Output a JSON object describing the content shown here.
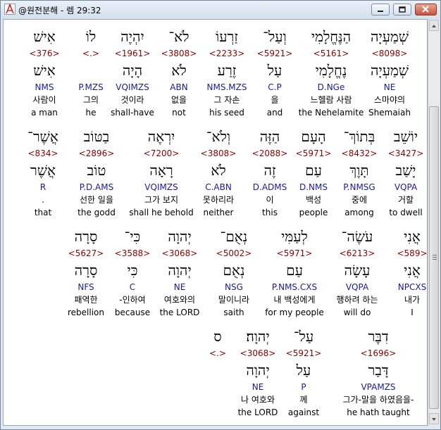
{
  "window": {
    "title": "@원전분해 - 렘 29:32",
    "colors": {
      "strong": "#8b0000",
      "morph": "#1a1aa0",
      "text": "#000000"
    }
  },
  "icons": {
    "app": "compass-drafting-icon",
    "minimize": "minimize-icon",
    "maximize": "maximize-icon",
    "close": "close-icon"
  },
  "lines": [
    {
      "words": [
        {
          "heb": "שְׁמַעְיָה",
          "strong": "<8098>",
          "heb2": "שְׁמַעְיָה",
          "morph": "NE",
          "kor": "스마야의",
          "eng": "Shemaiah"
        },
        {
          "heb": "הַנֶּחֱלָמִי",
          "strong": "<5161>",
          "heb2": "נֶחֱלָמִי",
          "morph": "D.NGe",
          "kor": "느헬람 사람",
          "eng": "the Nehelamite"
        },
        {
          "heb": "וְעַל־",
          "strong": "<5921>",
          "heb2": "עַל",
          "morph": "C.P",
          "kor": "을",
          "eng": "and"
        },
        {
          "heb": "זַרְעוֹ",
          "strong": "<2233>",
          "heb2": "זֶרַע",
          "morph": "NMS.MZS",
          "kor": "그 자손",
          "eng": "his seed"
        },
        {
          "heb": "לֹא־",
          "strong": "<3808>",
          "heb2": "לֹא",
          "morph": "ABN",
          "kor": "없을",
          "eng": "not"
        },
        {
          "heb": "יִהְיֶה",
          "strong": "<1961>",
          "heb2": "הָיָה",
          "morph": "VQIMZS",
          "kor": "것이라",
          "eng": "shall-have"
        },
        {
          "heb": "לוֹ",
          "strong": "<.>",
          "heb2": "",
          "morph": "P.MZS",
          "kor": "그의",
          "eng": "he"
        },
        {
          "heb": "אִישׁ",
          "strong": "<376>",
          "heb2": "אִישׁ",
          "morph": "NMS",
          "kor": "사람이",
          "eng": "a man"
        }
      ]
    },
    {
      "words": [
        {
          "heb": "יוֹשֵׁב",
          "strong": "<3427>",
          "heb2": "יָשַׁב",
          "morph": "VQPA",
          "kor": "거할",
          "eng": "to dwell"
        },
        {
          "heb": "בְּתוֹךְ־",
          "strong": "<8432>",
          "heb2": "תָּוֶךְ",
          "morph": "P.NMSG",
          "kor": "중에",
          "eng": "among"
        },
        {
          "heb": "הָעָם",
          "strong": "<5971>",
          "heb2": "עַם",
          "morph": "D.NMS",
          "kor": "백성",
          "eng": "people"
        },
        {
          "heb": "הַזֶּה",
          "strong": "<2088>",
          "heb2": "זֶה",
          "morph": "D.ADMS",
          "kor": "이",
          "eng": "this"
        },
        {
          "heb": "וְלֹא־",
          "strong": "<3808>",
          "heb2": "לֹא",
          "morph": "C.ABN",
          "kor": "못하리라",
          "eng": "neither"
        },
        {
          "heb": "יִרְאֶה",
          "strong": "<7200>",
          "heb2": "רָאָה",
          "morph": "VQIMZS",
          "kor": "그가 보지",
          "eng": "shall he behold"
        },
        {
          "heb": "בַטּוֹב",
          "strong": "<2896>",
          "heb2": "טוֹב",
          "morph": "P.D.AMS",
          "kor": "선한 일을",
          "eng": "the godd"
        },
        {
          "heb": "אֲשֶׁר־",
          "strong": "<834>",
          "heb2": "אֲשֶׁר",
          "morph": "R",
          "kor": ".",
          "eng": "that"
        }
      ]
    },
    {
      "words": [
        {
          "heb": "אֲנִי",
          "strong": "<589>",
          "heb2": "אֲנִי",
          "morph": "NPCXS",
          "kor": "내가",
          "eng": "I"
        },
        {
          "heb": "עֹשֶׂה־",
          "strong": "<6213>",
          "heb2": "עָשָׂה",
          "morph": "VQPA",
          "kor": "행하려 하는",
          "eng": "will do"
        },
        {
          "heb": "לְעַמִּי",
          "strong": "<5971>",
          "heb2": "עַם",
          "morph": "P.NMS.CXS",
          "kor": "내 백성에게",
          "eng": "for my people"
        },
        {
          "heb": "נְאֻם־",
          "strong": "<5002>",
          "heb2": "נְאֻם",
          "morph": "NSG",
          "kor": "말이니라",
          "eng": "saith"
        },
        {
          "heb": "יְהוָה",
          "strong": "<3068>",
          "heb2": "יְהוָה",
          "morph": "NE",
          "kor": "여호와의",
          "eng": "the LORD"
        },
        {
          "heb": "כִּי־",
          "strong": "<3588>",
          "heb2": "כִּי",
          "morph": "C",
          "kor": "-인하여",
          "eng": "because"
        },
        {
          "heb": "סָרָה",
          "strong": "<5627>",
          "heb2": "סָרָה",
          "morph": "NFS",
          "kor": "패역한",
          "eng": "rebellion"
        }
      ]
    },
    {
      "words": [
        {
          "heb": "דִבֶּר",
          "strong": "<1696>",
          "heb2": "דָּבַר",
          "morph": "VPAMZS",
          "kor": "그가-말을 하였음을-",
          "eng": "he hath taught"
        },
        {
          "heb": "עַל־",
          "strong": "<5921>",
          "heb2": "עַל",
          "morph": "P",
          "kor": "께",
          "eng": "against"
        },
        {
          "heb": "יְהוָה׃",
          "strong": "<3068>",
          "heb2": "יְהוָה",
          "morph": "NE",
          "kor": "나 여호와",
          "eng": "the LORD"
        },
        {
          "heb": "ס",
          "strong": "<.>",
          "heb2": "",
          "morph": "",
          "kor": "",
          "eng": ""
        }
      ]
    }
  ]
}
